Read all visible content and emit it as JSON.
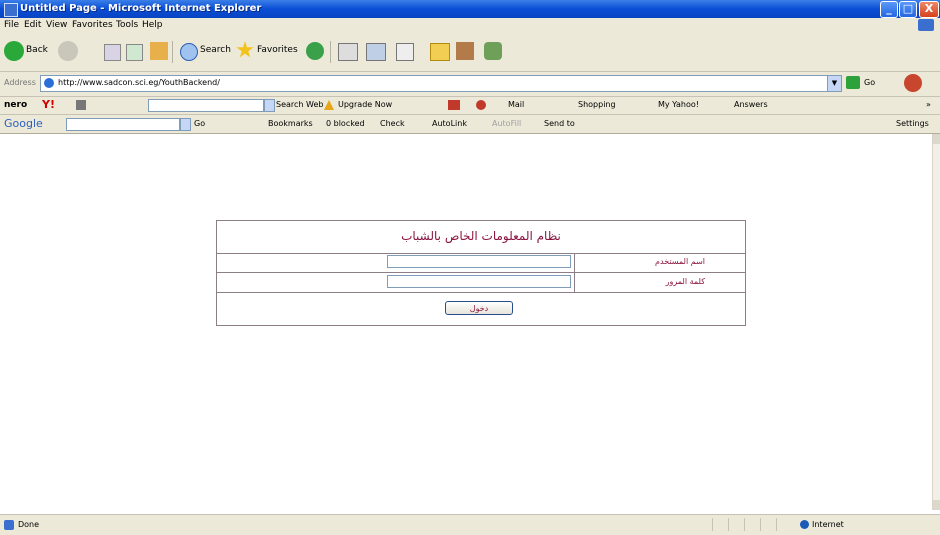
{
  "window": {
    "title": "Untitled Page - Microsoft Internet Explorer",
    "minimize_label": "_",
    "maximize_label": "□",
    "close_label": "X"
  },
  "menu": {
    "items": [
      "File",
      "Edit",
      "View",
      "Favorites",
      "Tools",
      "Help"
    ]
  },
  "toolbar": {
    "back_label": "Back",
    "search_label": "Search",
    "favorites_label": "Favorites"
  },
  "address": {
    "label": "Address",
    "url": "http://www.sadcon.sci.eg/YouthBackend/",
    "go_label": "Go"
  },
  "yahoo_toolbar": {
    "nero_label": "nero",
    "yahoo_label": "Y!",
    "search_web_label": "Search Web",
    "upgrade_label": "Upgrade Now",
    "mail_label": "Mail",
    "shopping_label": "Shopping",
    "myyahoo_label": "My Yahoo!",
    "answers_label": "Answers"
  },
  "google_toolbar": {
    "logo": "Google",
    "go_label": "Go",
    "bookmarks_label": "Bookmarks",
    "blocked_label": "0 blocked",
    "check_label": "Check",
    "autolink_label": "AutoLink",
    "autofill_label": "AutoFill",
    "sendto_label": "Send to",
    "settings_label": "Settings"
  },
  "login": {
    "title": "نظام المعلومات الخاص بالشباب",
    "username_label": "اسم المستخدم",
    "password_label": "كلمة المرور",
    "submit_label": "دخول"
  },
  "status": {
    "text": "Done",
    "zone": "Internet"
  }
}
